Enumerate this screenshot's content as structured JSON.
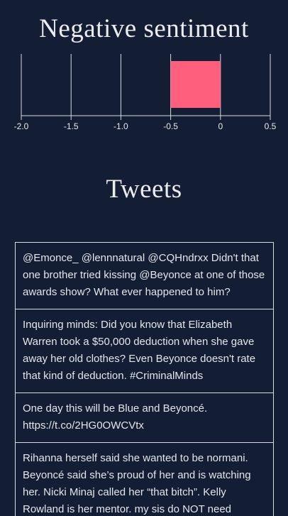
{
  "header": {
    "sentiment_title": "Negative sentiment",
    "tweets_title": "Tweets"
  },
  "colors": {
    "background": "#131d33",
    "bar": "#fd5f7d",
    "axis": "#d8dbe2"
  },
  "chart_data": {
    "type": "bar",
    "orientation": "horizontal",
    "categories": [
      ""
    ],
    "values": [
      -0.5
    ],
    "xlim": [
      -2.0,
      0.5
    ],
    "ticks": [
      -2.0,
      -1.5,
      -1.0,
      -0.5,
      0,
      0.5
    ],
    "tick_labels": [
      "-2.0",
      "-1.5",
      "-1.0",
      "-0.5",
      "0",
      "0.5"
    ],
    "grid": true
  },
  "tweets": [
    {
      "text": "@Emonce_ @lennnatural @CQHndrxx Didn't that one brother tried kissing @Beyonce at one of those awards show? What ever happened to him?"
    },
    {
      "text": "Inquiring minds: Did you know that Elizabeth Warren took a $50,000 deduction when she gave away her old clothes? Even Beyonce doesn't rate that kind of deduction. #CriminalMinds"
    },
    {
      "text": "One day this will be Blue and Beyoncé. https://t.co/2HG0OWCVtx"
    },
    {
      "text": "Rihanna herself said she wanted to be normani. Beyoncé said she’s proud of her and is watching her. Nicki Minaj called her “that bitch”. Kelly Rowland is her mentor. my sis do NOT need"
    }
  ]
}
